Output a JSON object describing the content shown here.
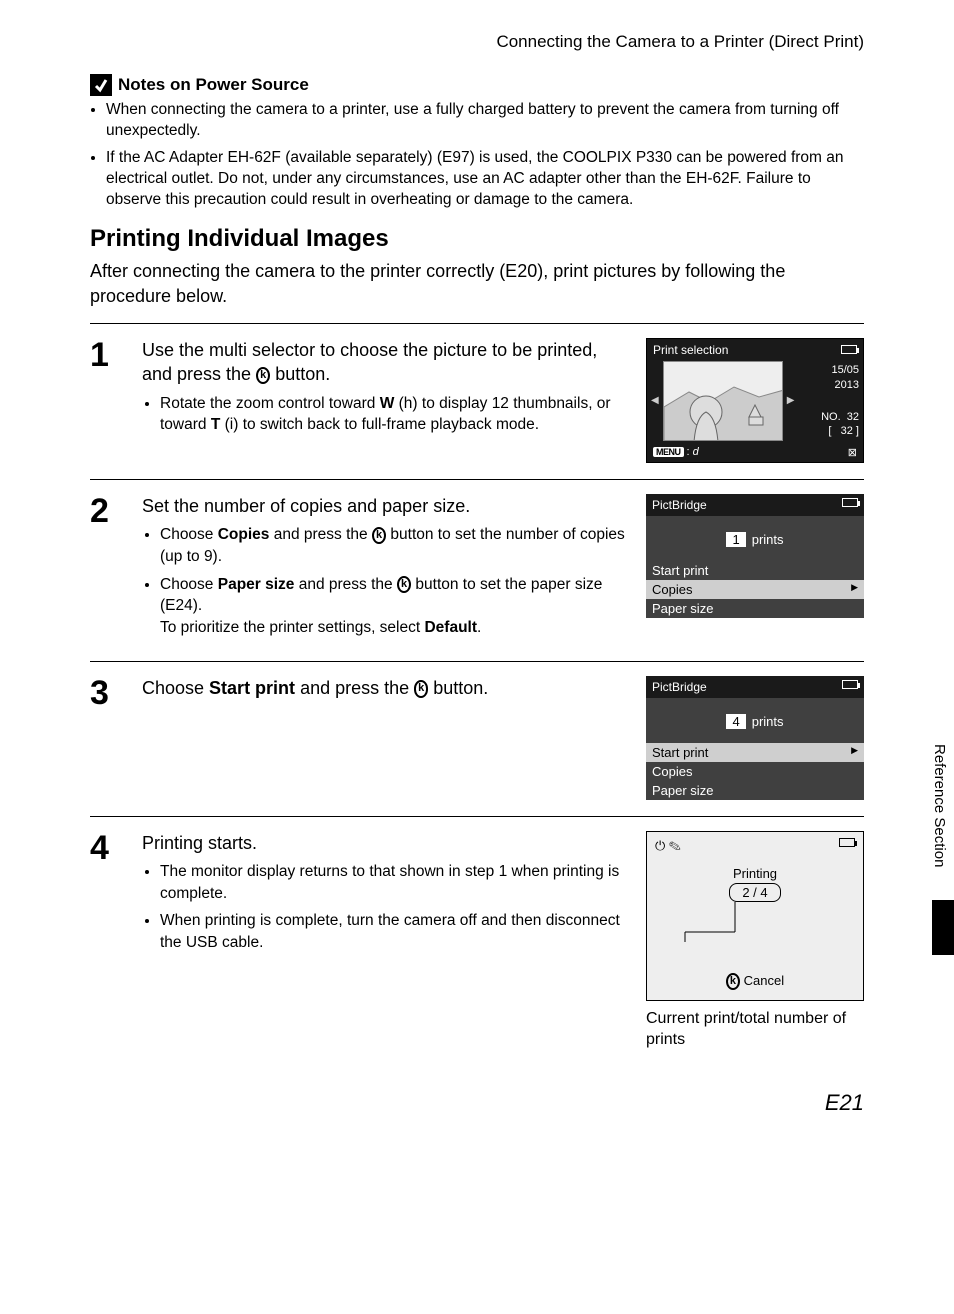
{
  "breadcrumb": "Connecting the Camera to a Printer (Direct Print)",
  "notes_heading": "Notes on Power Source",
  "notes": [
    "When connecting the camera to a printer, use a fully charged battery to prevent the camera from turning off unexpectedly.",
    "If the AC Adapter EH-62F (available separately) (E97) is used, the COOLPIX P330 can be powered from an electrical outlet. Do not, under any circumstances, use an AC adapter other than the EH-62F. Failure to observe this precaution could result in overheating or damage to the camera."
  ],
  "section_title": "Printing Individual Images",
  "intro": "After connecting the camera to the printer correctly (E20), print pictures by following the procedure below.",
  "side_label": "Reference Section",
  "steps": {
    "s1": {
      "num": "1",
      "head_a": "Use the multi selector to choose the picture to be printed, and press the ",
      "head_b": " button.",
      "bullet_a": "Rotate the zoom control toward ",
      "bullet_w": "W",
      "bullet_mid": " (h) to display 12 thumbnails, or toward ",
      "bullet_t": "T",
      "bullet_end": " (i) to switch back to full-frame playback mode."
    },
    "s2": {
      "num": "2",
      "head": "Set the number of copies and paper size.",
      "b1_a": "Choose ",
      "b1_b": "Copies",
      "b1_c": " and press the ",
      "b1_d": " button to set the number of copies (up to 9).",
      "b2_a": "Choose ",
      "b2_b": "Paper size",
      "b2_c": " and press the ",
      "b2_d": " button to set the paper size (E24).",
      "b2_e": "To prioritize the printer settings, select ",
      "b2_f": "Default",
      "b2_g": "."
    },
    "s3": {
      "num": "3",
      "head_a": "Choose ",
      "head_b": "Start print",
      "head_c": " and press the ",
      "head_d": " button."
    },
    "s4": {
      "num": "4",
      "head": "Printing starts.",
      "b1": "The monitor display returns to that shown in step 1 when printing is complete.",
      "b2": "When printing is complete, turn the camera off and then disconnect the USB cable."
    }
  },
  "lcd1": {
    "title": "Print selection",
    "date1": "15/05",
    "date2": "2013",
    "no_label": "NO.",
    "no_val": "32",
    "count": "32",
    "menu": "MENU"
  },
  "lcd2": {
    "title": "PictBridge",
    "count": "1",
    "prints": "prints",
    "r1": "Start print",
    "r2": "Copies",
    "r3": "Paper size"
  },
  "lcd3": {
    "title": "PictBridge",
    "count": "4",
    "prints": "prints",
    "r1": "Start print",
    "r2": "Copies",
    "r3": "Paper size"
  },
  "lcd4": {
    "printing": "Printing",
    "progress": "2  /  4",
    "cancel": "Cancel",
    "caption": "Current print/total number of prints"
  },
  "ok_label": "k",
  "page_num": "E21"
}
